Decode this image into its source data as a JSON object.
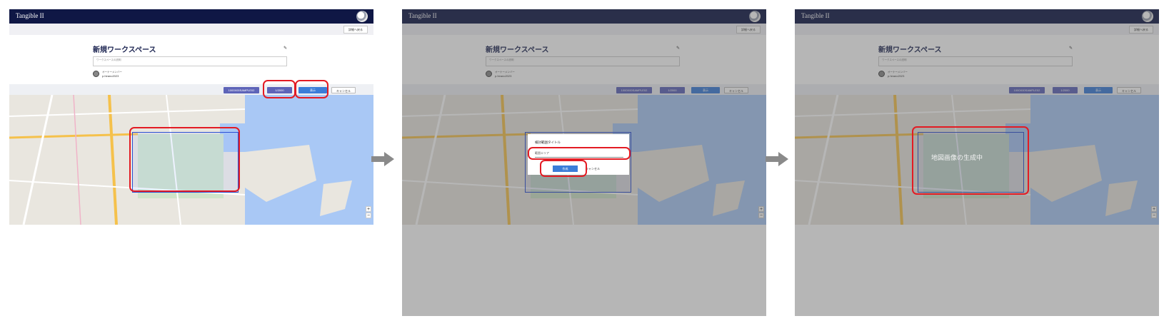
{
  "app": {
    "title": "Tangible II",
    "back_label": "詳細へ戻る"
  },
  "workspace": {
    "title": "新規ワークスペース",
    "description_placeholder": "ワークスペースの説明",
    "owner_role": "オーナーメンバー",
    "owner_name": "p.hirano2023"
  },
  "toolbar": {
    "scale_label": "1000X00SAMPLE02",
    "ratio_label": "1/2000",
    "show_label": "表示",
    "cancel_label": "キャンセル"
  },
  "map": {
    "zoom_in": "+",
    "zoom_out": "−"
  },
  "dialog": {
    "title": "検討範囲タイトル",
    "input_value": "範囲エリア",
    "ok_label": "作成",
    "cancel_label": "キャンセル"
  },
  "loading": {
    "text": "地図画像の生成中"
  },
  "colors": {
    "header": "#0f1745",
    "accent": "#3b7dd8",
    "highlight": "#e31b23",
    "selection": "#2a4fd3"
  }
}
